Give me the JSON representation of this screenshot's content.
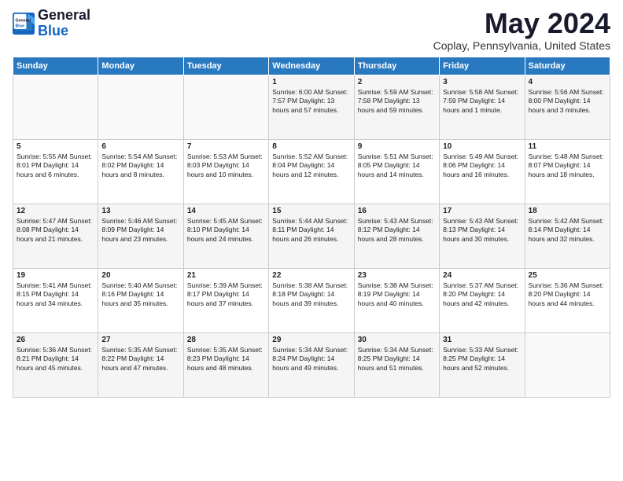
{
  "logo": {
    "line1": "General",
    "line2": "Blue"
  },
  "title": "May 2024",
  "subtitle": "Coplay, Pennsylvania, United States",
  "headers": [
    "Sunday",
    "Monday",
    "Tuesday",
    "Wednesday",
    "Thursday",
    "Friday",
    "Saturday"
  ],
  "weeks": [
    [
      {
        "day": "",
        "content": ""
      },
      {
        "day": "",
        "content": ""
      },
      {
        "day": "",
        "content": ""
      },
      {
        "day": "1",
        "content": "Sunrise: 6:00 AM\nSunset: 7:57 PM\nDaylight: 13 hours\nand 57 minutes."
      },
      {
        "day": "2",
        "content": "Sunrise: 5:59 AM\nSunset: 7:58 PM\nDaylight: 13 hours\nand 59 minutes."
      },
      {
        "day": "3",
        "content": "Sunrise: 5:58 AM\nSunset: 7:59 PM\nDaylight: 14 hours\nand 1 minute."
      },
      {
        "day": "4",
        "content": "Sunrise: 5:56 AM\nSunset: 8:00 PM\nDaylight: 14 hours\nand 3 minutes."
      }
    ],
    [
      {
        "day": "5",
        "content": "Sunrise: 5:55 AM\nSunset: 8:01 PM\nDaylight: 14 hours\nand 6 minutes."
      },
      {
        "day": "6",
        "content": "Sunrise: 5:54 AM\nSunset: 8:02 PM\nDaylight: 14 hours\nand 8 minutes."
      },
      {
        "day": "7",
        "content": "Sunrise: 5:53 AM\nSunset: 8:03 PM\nDaylight: 14 hours\nand 10 minutes."
      },
      {
        "day": "8",
        "content": "Sunrise: 5:52 AM\nSunset: 8:04 PM\nDaylight: 14 hours\nand 12 minutes."
      },
      {
        "day": "9",
        "content": "Sunrise: 5:51 AM\nSunset: 8:05 PM\nDaylight: 14 hours\nand 14 minutes."
      },
      {
        "day": "10",
        "content": "Sunrise: 5:49 AM\nSunset: 8:06 PM\nDaylight: 14 hours\nand 16 minutes."
      },
      {
        "day": "11",
        "content": "Sunrise: 5:48 AM\nSunset: 8:07 PM\nDaylight: 14 hours\nand 18 minutes."
      }
    ],
    [
      {
        "day": "12",
        "content": "Sunrise: 5:47 AM\nSunset: 8:08 PM\nDaylight: 14 hours\nand 21 minutes."
      },
      {
        "day": "13",
        "content": "Sunrise: 5:46 AM\nSunset: 8:09 PM\nDaylight: 14 hours\nand 23 minutes."
      },
      {
        "day": "14",
        "content": "Sunrise: 5:45 AM\nSunset: 8:10 PM\nDaylight: 14 hours\nand 24 minutes."
      },
      {
        "day": "15",
        "content": "Sunrise: 5:44 AM\nSunset: 8:11 PM\nDaylight: 14 hours\nand 26 minutes."
      },
      {
        "day": "16",
        "content": "Sunrise: 5:43 AM\nSunset: 8:12 PM\nDaylight: 14 hours\nand 28 minutes."
      },
      {
        "day": "17",
        "content": "Sunrise: 5:43 AM\nSunset: 8:13 PM\nDaylight: 14 hours\nand 30 minutes."
      },
      {
        "day": "18",
        "content": "Sunrise: 5:42 AM\nSunset: 8:14 PM\nDaylight: 14 hours\nand 32 minutes."
      }
    ],
    [
      {
        "day": "19",
        "content": "Sunrise: 5:41 AM\nSunset: 8:15 PM\nDaylight: 14 hours\nand 34 minutes."
      },
      {
        "day": "20",
        "content": "Sunrise: 5:40 AM\nSunset: 8:16 PM\nDaylight: 14 hours\nand 35 minutes."
      },
      {
        "day": "21",
        "content": "Sunrise: 5:39 AM\nSunset: 8:17 PM\nDaylight: 14 hours\nand 37 minutes."
      },
      {
        "day": "22",
        "content": "Sunrise: 5:38 AM\nSunset: 8:18 PM\nDaylight: 14 hours\nand 39 minutes."
      },
      {
        "day": "23",
        "content": "Sunrise: 5:38 AM\nSunset: 8:19 PM\nDaylight: 14 hours\nand 40 minutes."
      },
      {
        "day": "24",
        "content": "Sunrise: 5:37 AM\nSunset: 8:20 PM\nDaylight: 14 hours\nand 42 minutes."
      },
      {
        "day": "25",
        "content": "Sunrise: 5:36 AM\nSunset: 8:20 PM\nDaylight: 14 hours\nand 44 minutes."
      }
    ],
    [
      {
        "day": "26",
        "content": "Sunrise: 5:36 AM\nSunset: 8:21 PM\nDaylight: 14 hours\nand 45 minutes."
      },
      {
        "day": "27",
        "content": "Sunrise: 5:35 AM\nSunset: 8:22 PM\nDaylight: 14 hours\nand 47 minutes."
      },
      {
        "day": "28",
        "content": "Sunrise: 5:35 AM\nSunset: 8:23 PM\nDaylight: 14 hours\nand 48 minutes."
      },
      {
        "day": "29",
        "content": "Sunrise: 5:34 AM\nSunset: 8:24 PM\nDaylight: 14 hours\nand 49 minutes."
      },
      {
        "day": "30",
        "content": "Sunrise: 5:34 AM\nSunset: 8:25 PM\nDaylight: 14 hours\nand 51 minutes."
      },
      {
        "day": "31",
        "content": "Sunrise: 5:33 AM\nSunset: 8:25 PM\nDaylight: 14 hours\nand 52 minutes."
      },
      {
        "day": "",
        "content": ""
      }
    ]
  ]
}
